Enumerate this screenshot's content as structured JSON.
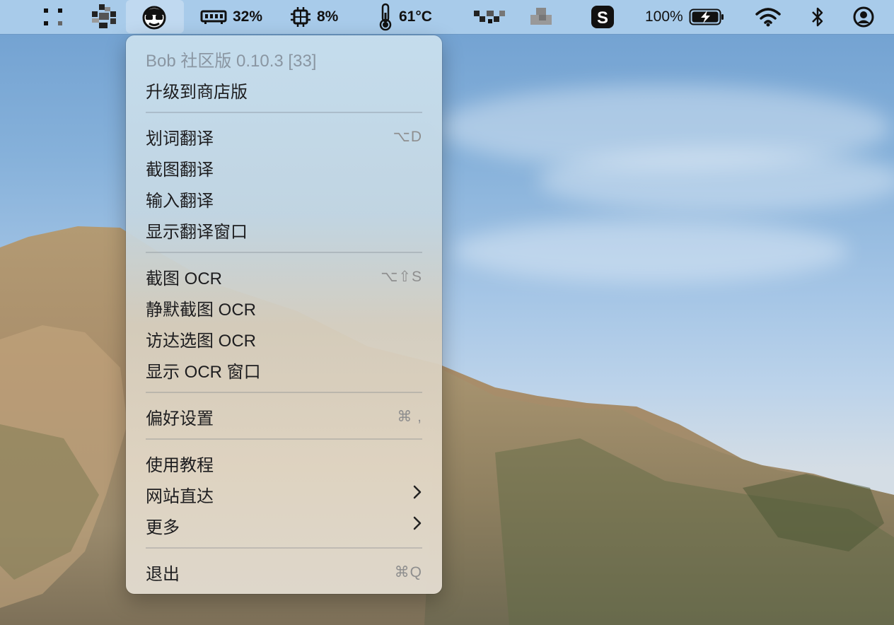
{
  "menubar": {
    "memory_pct": "32%",
    "cpu_pct": "8%",
    "temperature": "61°C",
    "battery_pct": "100%",
    "icons": [
      "dots-grid-icon",
      "pixel-app-icon",
      "bob-app-icon",
      "memory-icon",
      "cpu-icon",
      "thermometer-icon",
      "pixel-app-icon-2",
      "pixel-app-icon-3",
      "sogou-input-icon",
      "battery-charging-icon",
      "wifi-icon",
      "bluetooth-icon",
      "user-account-icon"
    ]
  },
  "menu": {
    "version": "Bob 社区版 0.10.3 [33]",
    "upgrade": "升级到商店版",
    "translate_selection": "划词翻译",
    "translate_selection_sc": "⌥D",
    "translate_screenshot": "截图翻译",
    "translate_input": "输入翻译",
    "show_translate_window": "显示翻译窗口",
    "ocr_screenshot": "截图 OCR",
    "ocr_screenshot_sc": "⌥⇧S",
    "ocr_silent": "静默截图 OCR",
    "ocr_finder": "访达选图 OCR",
    "show_ocr_window": "显示 OCR 窗口",
    "preferences": "偏好设置",
    "preferences_sc": "⌘ ,",
    "tutorial": "使用教程",
    "website": "网站直达",
    "more": "更多",
    "quit": "退出",
    "quit_sc": "⌘Q"
  }
}
